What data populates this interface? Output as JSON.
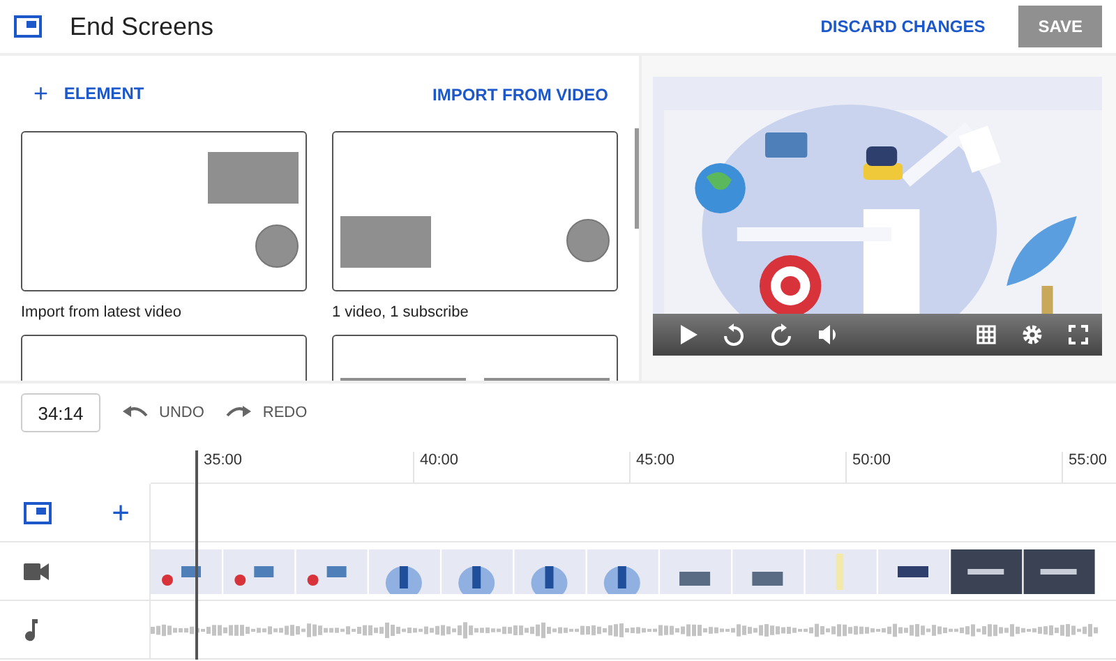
{
  "header": {
    "title": "End Screens",
    "discard": "DISCARD CHANGES",
    "save": "SAVE"
  },
  "actions": {
    "add_icon": "+",
    "add_label": "ELEMENT",
    "import": "IMPORT FROM VIDEO"
  },
  "templates": [
    {
      "kind": "video-top-subscribe",
      "label": "Import from latest video"
    },
    {
      "kind": "video-left-subscribe",
      "label": "1 video, 1 subscribe"
    },
    {
      "kind": "blank"
    },
    {
      "kind": "two-videos"
    }
  ],
  "toolbar": {
    "time": "34:14",
    "undo": "UNDO",
    "redo": "REDO"
  },
  "ruler": {
    "ticks": [
      "35:00",
      "40:00",
      "45:00",
      "50:00",
      "55:00"
    ]
  },
  "tracks": {
    "add_icon": "+"
  }
}
